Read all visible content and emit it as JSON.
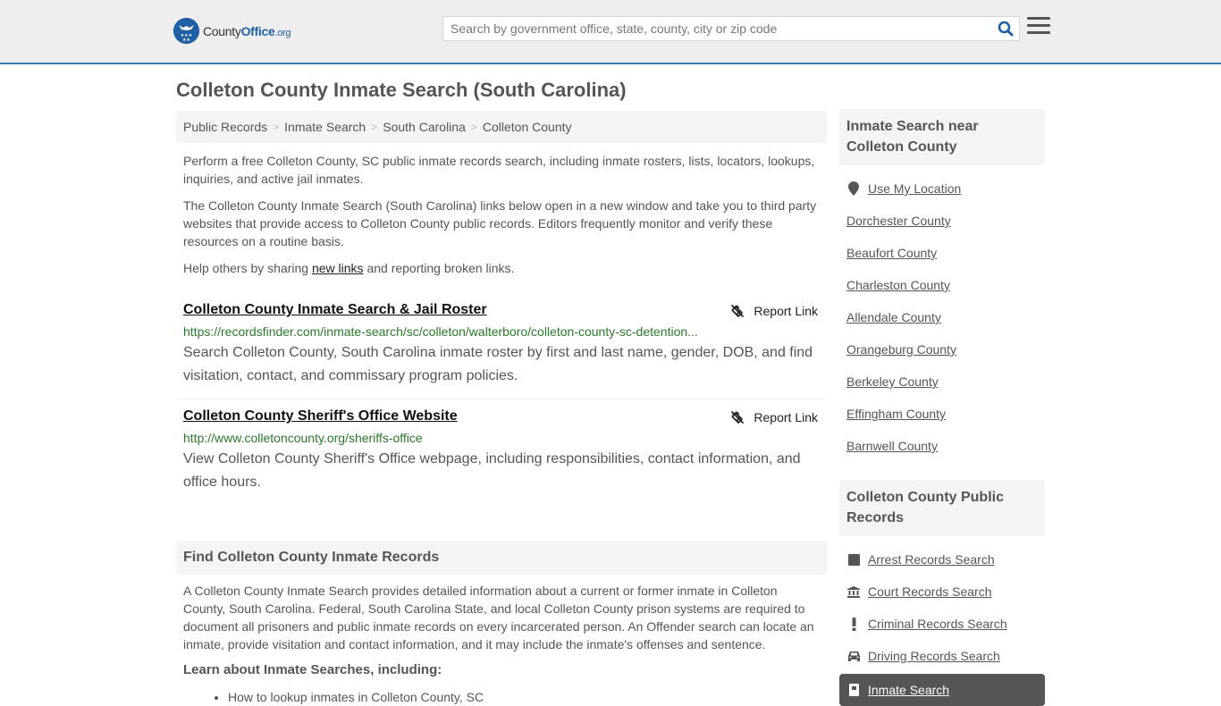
{
  "header": {
    "logo_county": "County",
    "logo_office": "Office",
    "logo_org": ".org",
    "search_placeholder": "Search by government office, state, county, city or zip code",
    "search_value": ""
  },
  "page": {
    "title": "Colleton County Inmate Search (South Carolina)"
  },
  "breadcrumb": [
    "Public Records",
    "Inmate Search",
    "South Carolina",
    "Colleton County"
  ],
  "breadcrumb_separator": ">",
  "intro": {
    "p1": "Perform a free Colleton County, SC public inmate records search, including inmate rosters, lists, locators, lookups, inquiries, and active jail inmates.",
    "p2": "The Colleton County Inmate Search (South Carolina) links below open in a new window and take you to third party websites that provide access to Colleton County public records. Editors frequently monitor and verify these resources on a routine basis.",
    "p3_before": "Help others by sharing ",
    "p3_link": "new links",
    "p3_after": " and reporting broken links."
  },
  "links": [
    {
      "title": "Colleton County Inmate Search & Jail Roster",
      "url": "https://recordsfinder.com/inmate-search/sc/colleton/walterboro/colleton-county-sc-detention...",
      "description": "Search Colleton County, South Carolina inmate roster by first and last name, gender, DOB, and find visitation, contact, and commissary program policies.",
      "report_label": "Report Link"
    },
    {
      "title": "Colleton County Sheriff's Office Website",
      "url": "http://www.colletoncounty.org/sheriffs-office",
      "description": "View Colleton County Sheriff's Office webpage, including responsibilities, contact information, and office hours.",
      "report_label": "Report Link"
    }
  ],
  "find_section": {
    "heading": "Find Colleton County Inmate Records",
    "body": "A Colleton County Inmate Search provides detailed information about a current or former inmate in Colleton County, South Carolina. Federal, South Carolina State, and local Colleton County prison systems are required to document all prisoners and public inmate records on every incarcerated person. An Offender search can locate an inmate, provide visitation and contact information, and it may include the inmate's offenses and sentence.",
    "subheading": "Learn about Inmate Searches, including:",
    "list": [
      "How to lookup inmates in Colleton County, SC"
    ]
  },
  "sidebar": {
    "nearby_heading": "Inmate Search near Colleton County",
    "use_location": "Use My Location",
    "nearby": [
      "Dorchester County",
      "Beaufort County",
      "Charleston County",
      "Allendale County",
      "Orangeburg County",
      "Berkeley County",
      "Effingham County",
      "Barnwell County"
    ],
    "records_heading": "Colleton County Public Records",
    "records": [
      {
        "label": "Arrest Records Search",
        "icon": "book-icon"
      },
      {
        "label": "Court Records Search",
        "icon": "courthouse-icon"
      },
      {
        "label": "Criminal Records Search",
        "icon": "exclamation-icon"
      },
      {
        "label": "Driving Records Search",
        "icon": "car-icon"
      }
    ],
    "active_record": {
      "label": "Inmate Search",
      "icon": "inmate-door-icon"
    }
  },
  "colors": {
    "brand_blue": "#1f5fa6",
    "header_border": "#3a7cb2",
    "url_green": "#2b7a2b",
    "active_bg": "#555555"
  }
}
